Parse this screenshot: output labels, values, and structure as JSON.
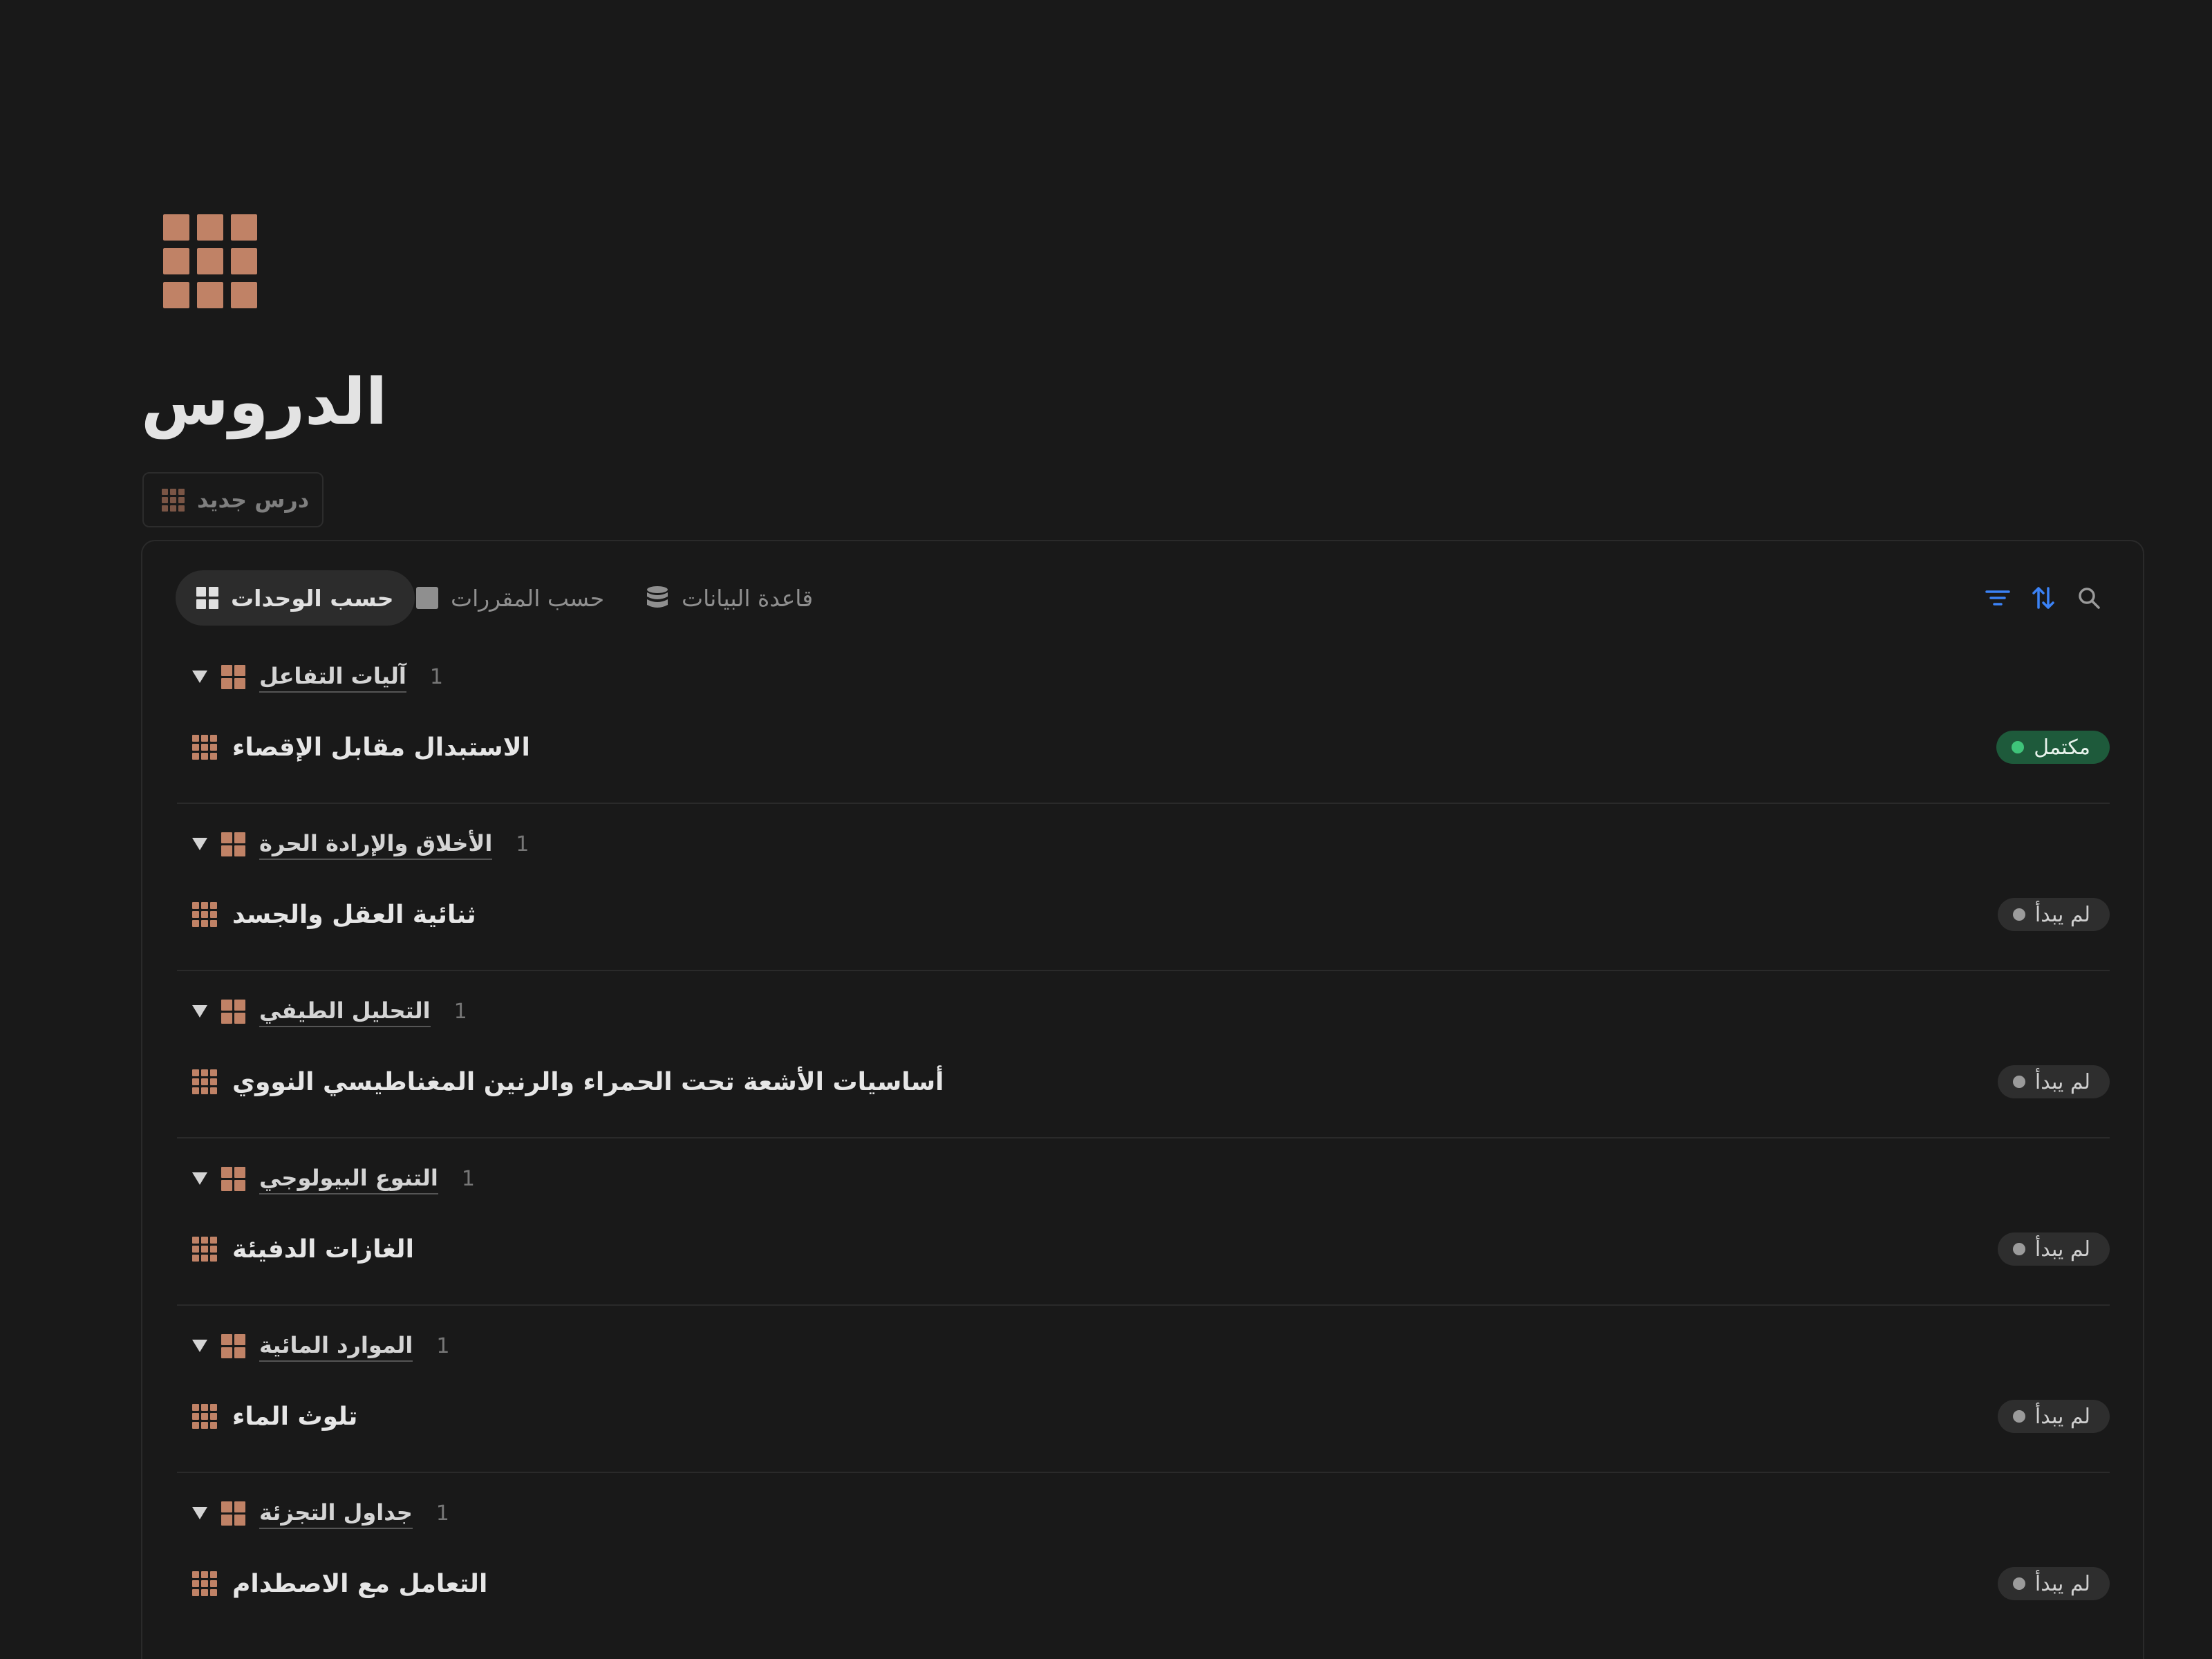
{
  "page": {
    "icon": "grid-icon",
    "title": "الدروس",
    "new_button_label": "درس جديد"
  },
  "toolbar": {
    "tabs": [
      {
        "label": "حسب الوحدات",
        "icon": "grid-icon",
        "active": true
      },
      {
        "label": "حسب المقررات",
        "icon": "square-icon",
        "active": false
      },
      {
        "label": "قاعدة البيانات",
        "icon": "database-icon",
        "active": false
      }
    ],
    "actions": [
      "filter-icon",
      "sort-icon",
      "search-icon"
    ]
  },
  "colors": {
    "accent_icon": "#c08266",
    "action_blue": "#3b82f6",
    "done_bg": "#1e5a3b",
    "done_dot": "#3fc47a",
    "todo_bg": "#2e2e2e"
  },
  "groups": [
    {
      "name": "آليات التفاعل",
      "count": "1",
      "item": {
        "title": "الاستبدال مقابل الإقصاء",
        "status": "مكتمل",
        "status_type": "done"
      }
    },
    {
      "name": "الأخلاق والإرادة الحرة",
      "count": "1",
      "item": {
        "title": "ثنائية العقل والجسد",
        "status": "لم يبدأ",
        "status_type": "todo"
      }
    },
    {
      "name": "التحليل الطيفي",
      "count": "1",
      "item": {
        "title": "أساسيات الأشعة تحت الحمراء والرنين المغناطيسي النووي",
        "status": "لم يبدأ",
        "status_type": "todo"
      }
    },
    {
      "name": "التنوع البيولوجي",
      "count": "1",
      "item": {
        "title": "الغازات الدفيئة",
        "status": "لم يبدأ",
        "status_type": "todo"
      }
    },
    {
      "name": "الموارد المائية",
      "count": "1",
      "item": {
        "title": "تلوث الماء",
        "status": "لم يبدأ",
        "status_type": "todo"
      }
    },
    {
      "name": "جداول التجزئة",
      "count": "1",
      "item": {
        "title": "التعامل مع الاصطدام",
        "status": "لم يبدأ",
        "status_type": "todo"
      }
    }
  ]
}
